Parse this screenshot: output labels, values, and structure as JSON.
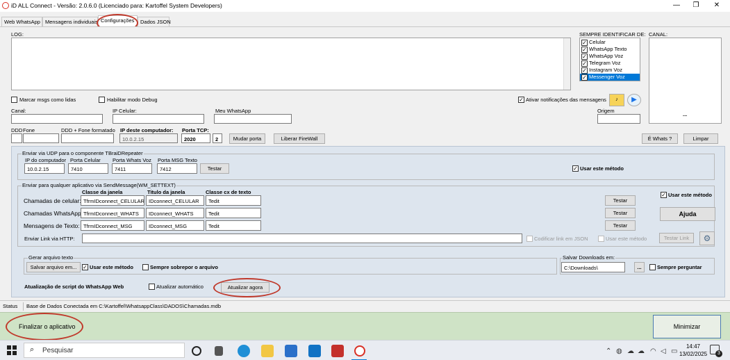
{
  "window": {
    "title": "iD ALL Connect - Versão: 2.0.6.0 (Licenciado para: Kartoffel System Developers)",
    "minimize": "—",
    "restore": "❐",
    "close": "✕"
  },
  "tabs": [
    "Web WhatsApp",
    "Mensagens individuais",
    "Configurações",
    "Dados JSON"
  ],
  "log": {
    "label": "LOG:"
  },
  "identify": {
    "label": "SEMPRE IDENTIFICAR DE:",
    "items": [
      "Celular",
      "WhatsApp Texto",
      "WhatsApp Voz",
      "Telegram Voz",
      "Instagram Voz",
      "Messenger Voz"
    ]
  },
  "canal_panel": {
    "label": "CANAL:",
    "ellipsis": "..."
  },
  "options": {
    "mark_read": "Marcar msgs como lidas",
    "debug": "Habilitar modo Debug",
    "notify": "Ativar notificações das mensagens"
  },
  "fields": {
    "canal": "Canal:",
    "ip_celular": "IP Celular:",
    "meu_whatsapp": "Meu WhatsApp",
    "origem": "Origem",
    "ddd": "DDD",
    "fone": "Fone",
    "ddd_fone_formatado": "DDD + Fone formatado",
    "ip_computador_label": "IP deste computador:",
    "ip_computador_value": "10.0.2.15",
    "porta_tcp_label": "Porta TCP:",
    "porta_tcp_value": "2020",
    "porta_tcp_extra": "2"
  },
  "buttons": {
    "mudar_porta": "Mudar porta",
    "liberar_firewall": "Liberar FireWall",
    "e_whats": "É Whats ?",
    "limpar": "Limpar",
    "testar": "Testar",
    "ajuda": "Ajuda",
    "testar_link": "Testar Link",
    "salvar_arquivo": "Salvar arquivo em...",
    "downloads_browse": "...",
    "atualizar_agora": "Atualizar agora",
    "finalizar": "Finalizar o aplicativo",
    "minimizar": "Minimizar"
  },
  "udp": {
    "group_label": "Enviar via UDP para o componente TBraiDRepeater",
    "ip_computador_label": "IP do computador",
    "ip_computador_value": "10.0.2.15",
    "porta_celular_label": "Porta Celular",
    "porta_celular_value": "7410",
    "porta_whats_voz_label": "Porta  Whats Voz",
    "porta_whats_voz_value": "7411",
    "porta_msg_texto_label": "Porta  MSG Texto",
    "porta_msg_texto_value": "7412",
    "usar_metodo": "Usar este método"
  },
  "sendmessage": {
    "group_label": "Enviar para qualquer aplicativo via SendMessage(WM_SETTEXT)",
    "col_classe": "Classe da janela",
    "col_titulo": "Titulo da janela",
    "col_classe_cx": "Classe cx de texto",
    "rows": [
      {
        "label": "Chamadas de celular:",
        "classe": "TfrmIDconnect_CELULAR",
        "titulo": "IDconnect_CELULAR",
        "cx": "Tedit"
      },
      {
        "label": "Chamadas WhatsApp:",
        "classe": "TfrmIDconnect_WHATS",
        "titulo": "IDconnect_WHATS",
        "cx": "Tedit"
      },
      {
        "label": "Mensagens de Texto:",
        "classe": "TfrmIDconnect_MSG",
        "titulo": "IDconnect_MSG",
        "cx": "Tedit"
      }
    ],
    "usar_metodo": "Usar este método",
    "link_http_label": "Enviar Link via HTTP:",
    "codificar_json": "Codificar link em JSON",
    "usar_metodo_http": "Usar este método"
  },
  "arquivo": {
    "group_label": "Gerar arquivo texto",
    "usar_metodo": "Usar este método",
    "sempre_sobrepor": "Sempre sobrepor o arquivo"
  },
  "downloads": {
    "label": "Salvar Downloads em:",
    "value": "C:\\Downloads\\",
    "sempre_perguntar": "Sempre perguntar"
  },
  "update": {
    "label": "Atualização de script do WhatsApp Web",
    "auto": "Atualizar automático"
  },
  "status": {
    "label": "Status",
    "text": "Base de Dados Conectada em C:\\Kartoffel\\WhatsappClass\\DADOS\\Chamadas.mdb"
  },
  "taskbar": {
    "search_placeholder": "Pesquisar",
    "time": "14:47",
    "date": "13/02/2025",
    "notifications": "3"
  },
  "colors": {
    "accent_red": "#c0392b",
    "panel_blue": "#dde5ee",
    "footer_green": "#cfe3c6",
    "selection_blue": "#0078d7"
  }
}
